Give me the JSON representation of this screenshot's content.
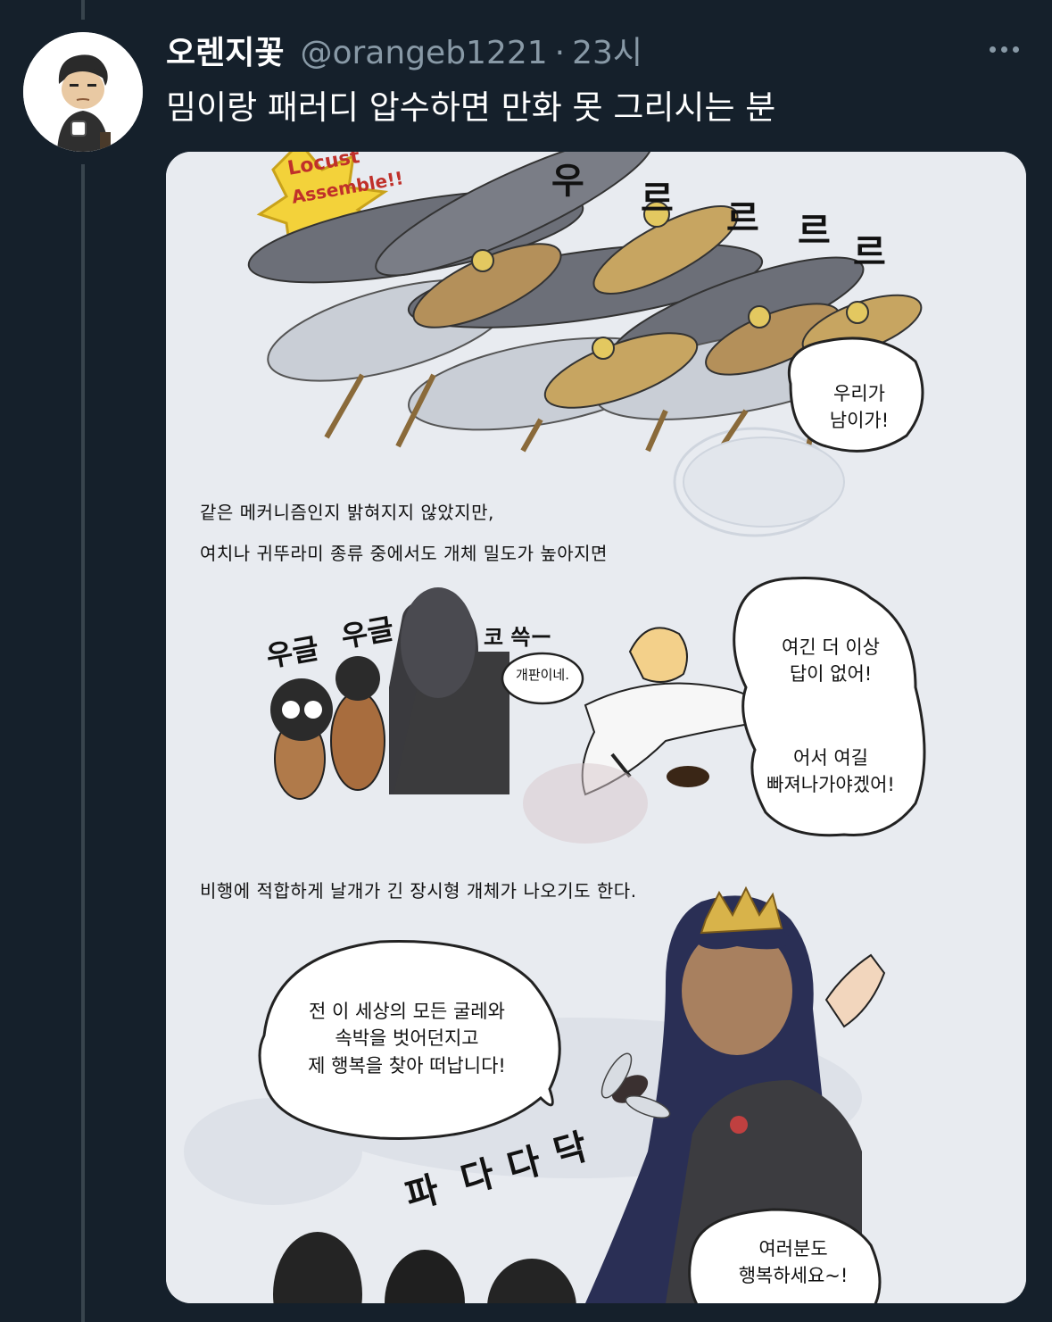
{
  "tweet": {
    "display_name": "오렌지꽃",
    "handle": "@orangeb1221",
    "separator": "·",
    "timestamp": "23시",
    "text": "밈이랑 패러디 압수하면 만화 못 그리시는 분"
  },
  "icons": {
    "more": "more-horizontal-icon",
    "avatar": "cartoon-avatar"
  },
  "colors": {
    "background": "#15202b",
    "secondary_text": "#8899a6",
    "thread_line": "#38444d"
  },
  "comic": {
    "badge": [
      "Locust",
      "Assemble!!"
    ],
    "sfx_top": [
      "우",
      "르",
      "르",
      "르",
      "르"
    ],
    "bubble_locust": [
      "우리가",
      "남이가!"
    ],
    "caption_1": "같은 메커니즘인지 밝혀지지 않았지만,",
    "caption_2": "여치나 귀뚜라미 종류 중에서도 개체 밀도가 높아지면",
    "sfx_woogle_1": "우글",
    "sfx_woogle_2": "우글",
    "sfx_sniff": "코 쓱ー",
    "bubble_mess": "개판이네.",
    "bubble_escape_1": [
      "여긴 더 이상",
      "답이 없어!"
    ],
    "bubble_escape_2": [
      "어서 여길",
      "빠져나가야겠어!"
    ],
    "caption_3": "비행에 적합하게 날개가 긴 장시형 개체가 나오기도 한다.",
    "bubble_princess": [
      "전 이 세상의 모든 굴레와",
      "속박을 벗어던지고",
      "제 행복을 찾아 떠납니다!"
    ],
    "sfx_flap": [
      "파",
      "다",
      "다",
      "닥"
    ],
    "bubble_bye": [
      "여러분도",
      "행복하세요~!"
    ]
  }
}
